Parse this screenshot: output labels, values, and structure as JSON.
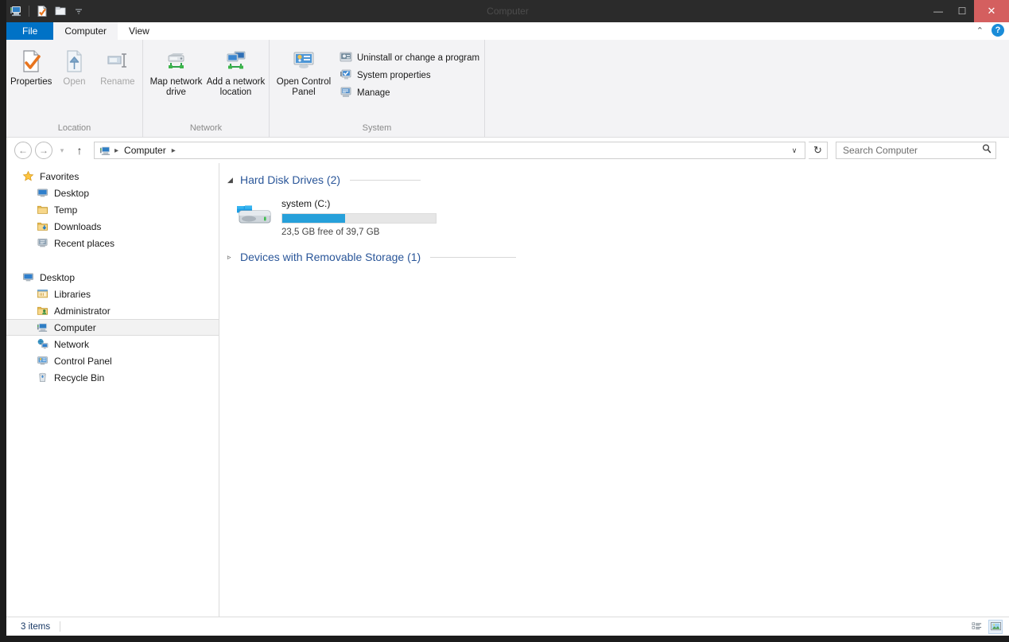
{
  "window": {
    "title": "Computer",
    "quick_access": [
      {
        "name": "computer-icon",
        "label": "Computer"
      },
      {
        "name": "properties-icon",
        "label": "Properties"
      },
      {
        "name": "folder-icon",
        "label": "New folder"
      },
      {
        "name": "chevron-down-icon",
        "label": "Customize Quick Access Toolbar"
      }
    ],
    "controls": {
      "minimize": "—",
      "maximize": "☐",
      "close": "✕"
    }
  },
  "tabs": [
    {
      "label": "File",
      "active": false,
      "style": "file"
    },
    {
      "label": "Computer",
      "active": true,
      "style": "normal"
    },
    {
      "label": "View",
      "active": false,
      "style": "normal"
    }
  ],
  "ribbon": {
    "collapse_icon": "⌃",
    "help_icon": "?",
    "groups": [
      {
        "label": "Location",
        "big_buttons": [
          {
            "label": "Properties",
            "icon": "properties-icon",
            "disabled": false
          },
          {
            "label": "Open",
            "icon": "open-icon",
            "disabled": true
          },
          {
            "label": "Rename",
            "icon": "rename-icon",
            "disabled": true
          }
        ]
      },
      {
        "label": "Network",
        "big_buttons": [
          {
            "label": "Map network drive",
            "icon": "map-network-drive-icon",
            "disabled": false,
            "dropdown": true
          },
          {
            "label": "Add a network location",
            "icon": "add-network-location-icon",
            "disabled": false
          }
        ]
      },
      {
        "label": "System",
        "big_buttons": [
          {
            "label": "Open Control Panel",
            "icon": "control-panel-icon",
            "disabled": false
          }
        ],
        "small_buttons": [
          {
            "label": "Uninstall or change a program",
            "icon": "uninstall-program-icon"
          },
          {
            "label": "System properties",
            "icon": "system-properties-icon"
          },
          {
            "label": "Manage",
            "icon": "manage-icon"
          }
        ]
      }
    ]
  },
  "addressbar": {
    "back": "←",
    "forward": "→",
    "recent_caret": "▾",
    "up": "↑",
    "crumb_icon": "computer-icon",
    "crumbs": [
      "Computer"
    ],
    "separator": "▸",
    "dropdown": "∨",
    "refresh": "↻"
  },
  "search": {
    "placeholder": "Search Computer",
    "icon": "search-icon"
  },
  "sidebar": {
    "sections": [
      {
        "header": {
          "label": "Favorites",
          "icon": "favorites-star-icon"
        },
        "items": [
          {
            "label": "Desktop",
            "icon": "desktop-icon"
          },
          {
            "label": "Temp",
            "icon": "folder-icon"
          },
          {
            "label": "Downloads",
            "icon": "downloads-folder-icon"
          },
          {
            "label": "Recent places",
            "icon": "recent-places-icon"
          }
        ]
      },
      {
        "header": {
          "label": "Desktop",
          "icon": "desktop-icon"
        },
        "items": [
          {
            "label": "Libraries",
            "icon": "libraries-icon",
            "selected": false
          },
          {
            "label": "Administrator",
            "icon": "user-folder-icon",
            "selected": false
          },
          {
            "label": "Computer",
            "icon": "computer-icon",
            "selected": true
          },
          {
            "label": "Network",
            "icon": "network-icon",
            "selected": false
          },
          {
            "label": "Control Panel",
            "icon": "control-panel-icon",
            "selected": false
          },
          {
            "label": "Recycle Bin",
            "icon": "recycle-bin-icon",
            "selected": false
          }
        ]
      }
    ]
  },
  "content": {
    "groups": [
      {
        "title": "Hard Disk Drives (2)",
        "expanded": true,
        "triangle": "◢",
        "drives": [
          {
            "name": "system (C:)",
            "icon": "windows-drive-icon",
            "free_text": "23,5 GB free of 39,7 GB",
            "used_percent": 41,
            "bar_color": "#26a0da"
          }
        ]
      },
      {
        "title": "Devices with Removable Storage (1)",
        "expanded": false,
        "triangle": "▹",
        "drives": []
      }
    ]
  },
  "statusbar": {
    "item_count": "3 items",
    "views": [
      {
        "name": "details-view-button",
        "active": false
      },
      {
        "name": "large-icons-view-button",
        "active": true
      }
    ]
  },
  "colors": {
    "accent_blue": "#0072c6",
    "title_bar": "#2b2b2b",
    "close_red": "#d45f5f",
    "group_header_blue": "#2a5699",
    "progress_blue": "#26a0da"
  }
}
